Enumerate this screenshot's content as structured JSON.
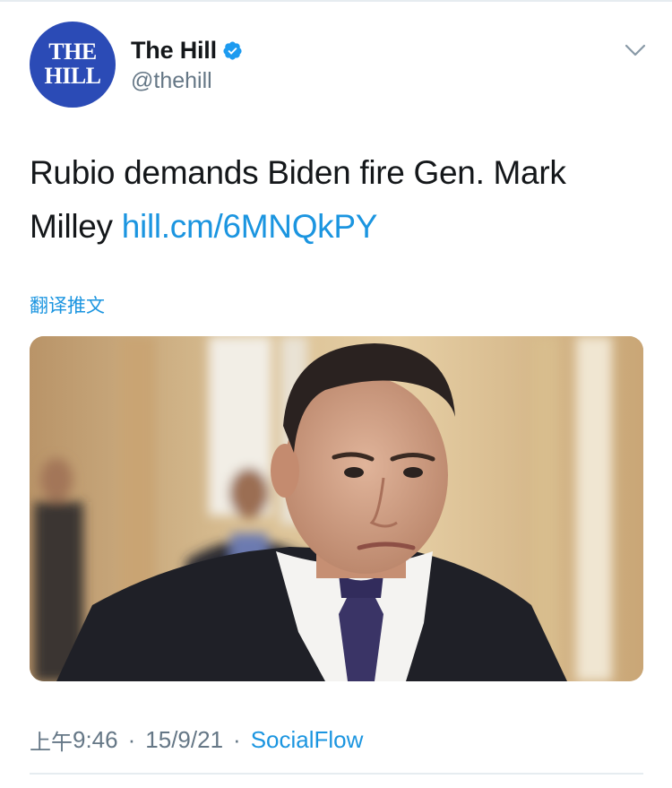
{
  "tweet": {
    "author": {
      "avatar_line1": "THE",
      "avatar_line2": "HILL",
      "display_name": "The Hill",
      "handle": "@thehill",
      "verified": true,
      "verified_icon": "verified-badge-icon",
      "avatar_color": "#2b4bb6"
    },
    "menu_icon": "chevron-down-icon",
    "text_part1": "Rubio demands Biden fire Gen. Mark Milley ",
    "link_text": "hill.cm/6MNQkPY",
    "translate_label": "翻译推文",
    "photo_icon": "photo-of-man-in-suit",
    "meta": {
      "time_prefix": "上午",
      "time": "9:46",
      "date": "15/9/21",
      "separator": "·",
      "source": "SocialFlow"
    },
    "colors": {
      "link": "#1b95e0",
      "secondary": "#657786",
      "primary": "#14171a",
      "divider": "#e6ecf0"
    }
  }
}
